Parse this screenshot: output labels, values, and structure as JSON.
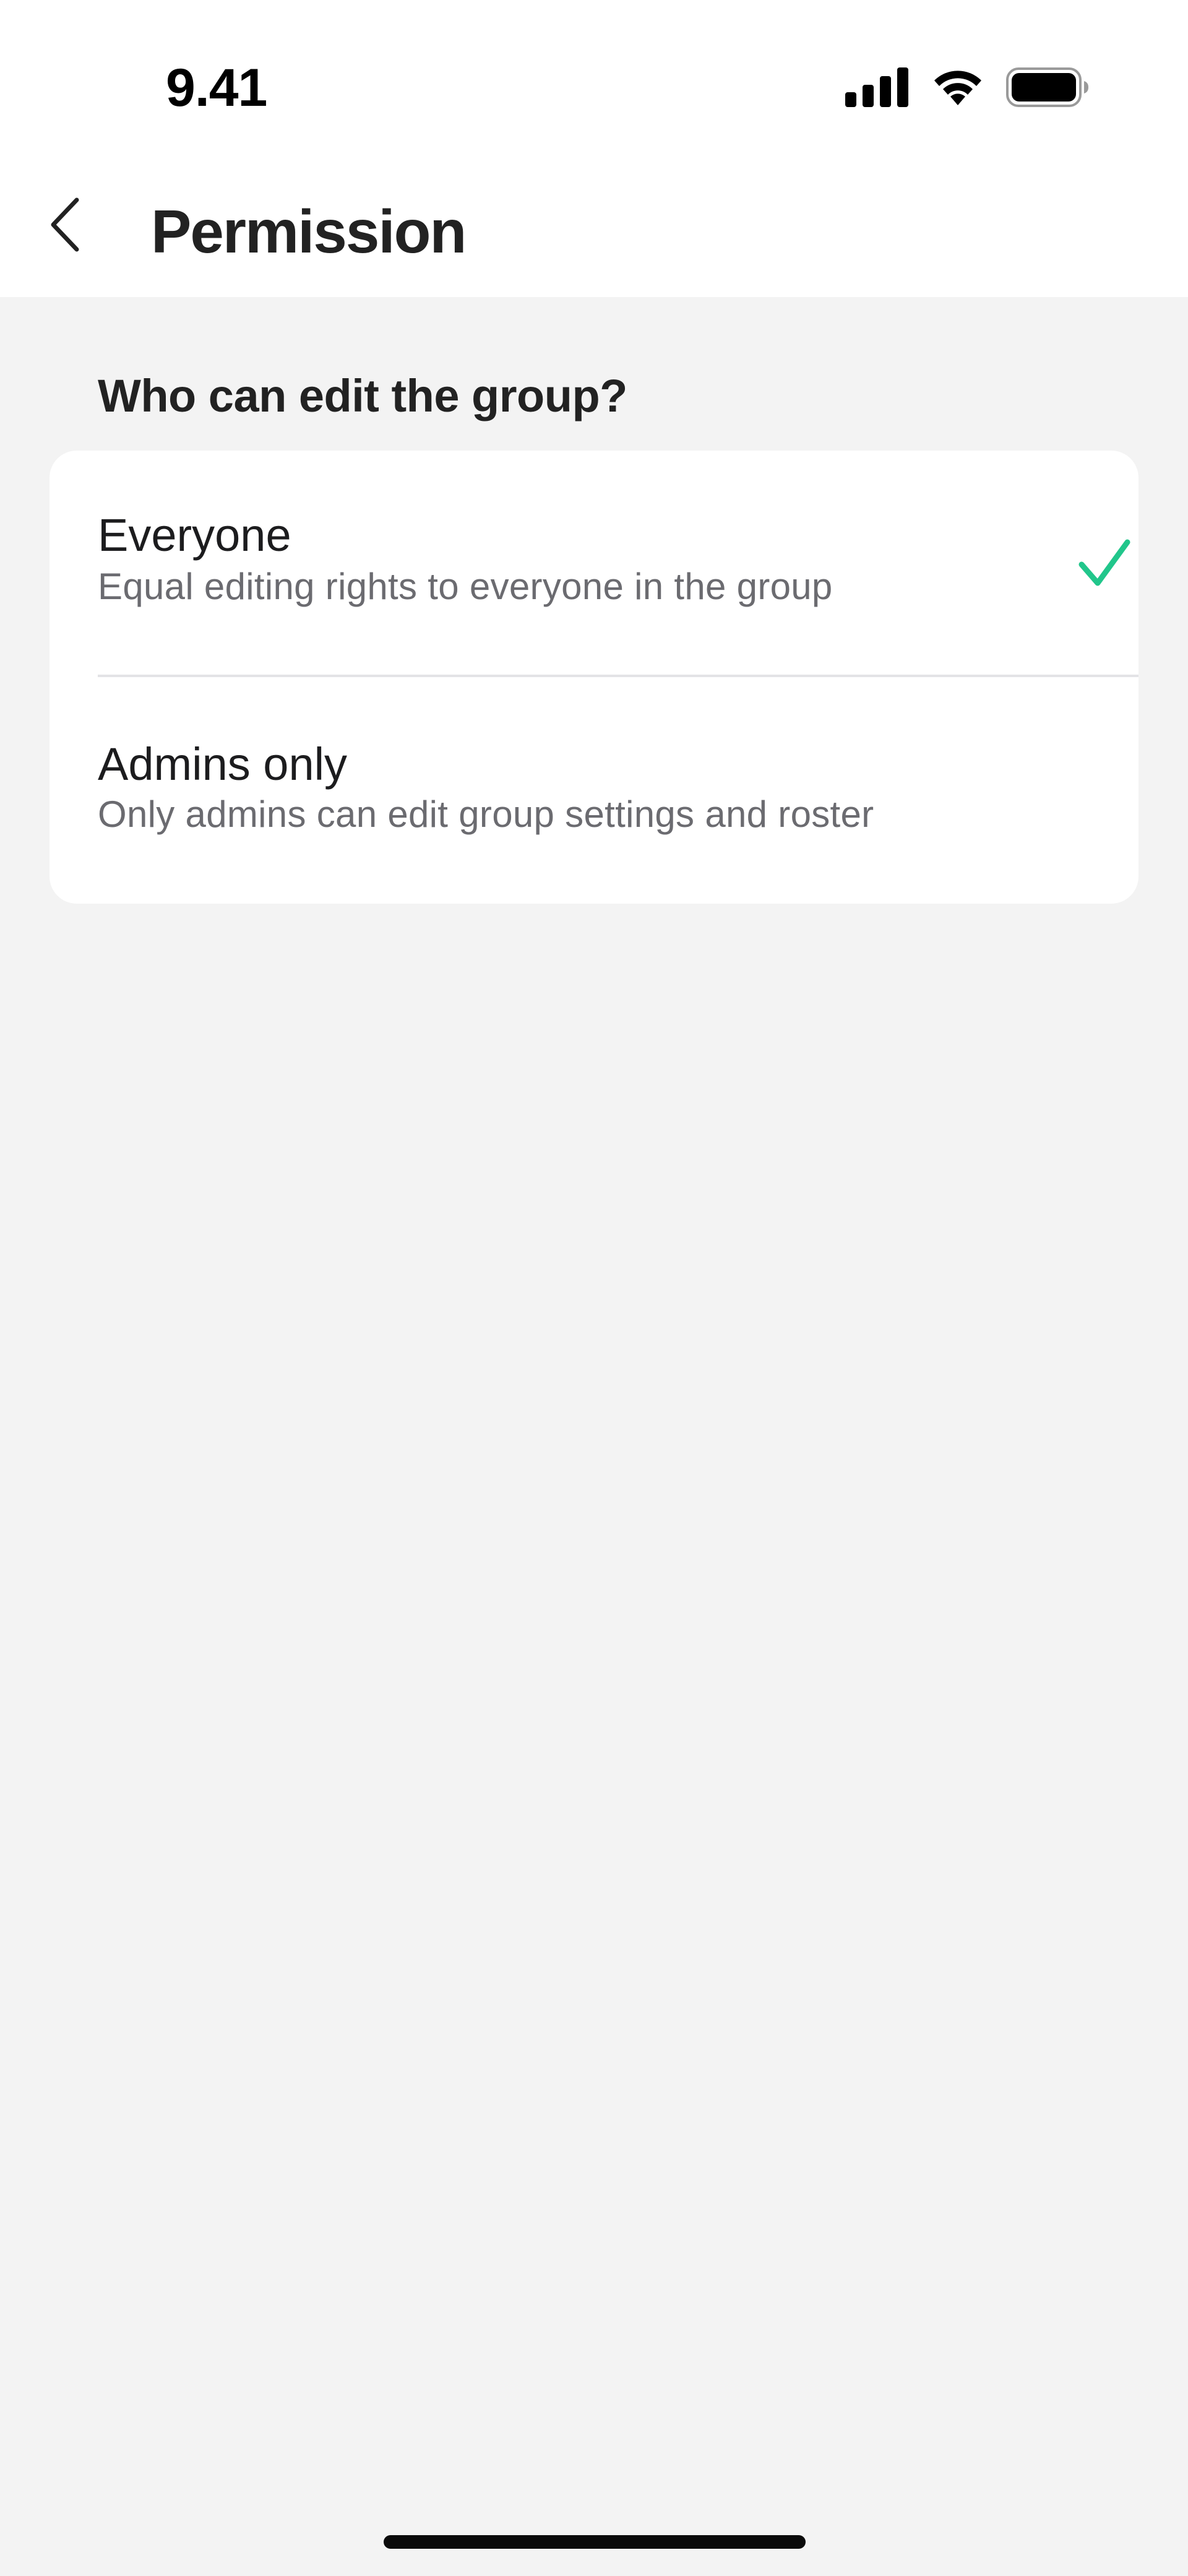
{
  "status_bar": {
    "time": "9.41",
    "icons": [
      "cellular-signal-icon",
      "wifi-icon",
      "battery-icon"
    ]
  },
  "nav": {
    "back_icon": "chevron-left-icon",
    "title": "Permission"
  },
  "section": {
    "heading": "Who can edit the group?"
  },
  "options": [
    {
      "title": "Everyone",
      "description": "Equal editing rights to everyone in the group",
      "selected": true
    },
    {
      "title": "Admins only",
      "description": "Only admins can edit group settings and roster",
      "selected": false
    }
  ],
  "colors": {
    "accent_check": "#21C68B",
    "background": "#F3F3F3",
    "card": "#FFFFFF",
    "secondary_text": "#6B6B70"
  }
}
